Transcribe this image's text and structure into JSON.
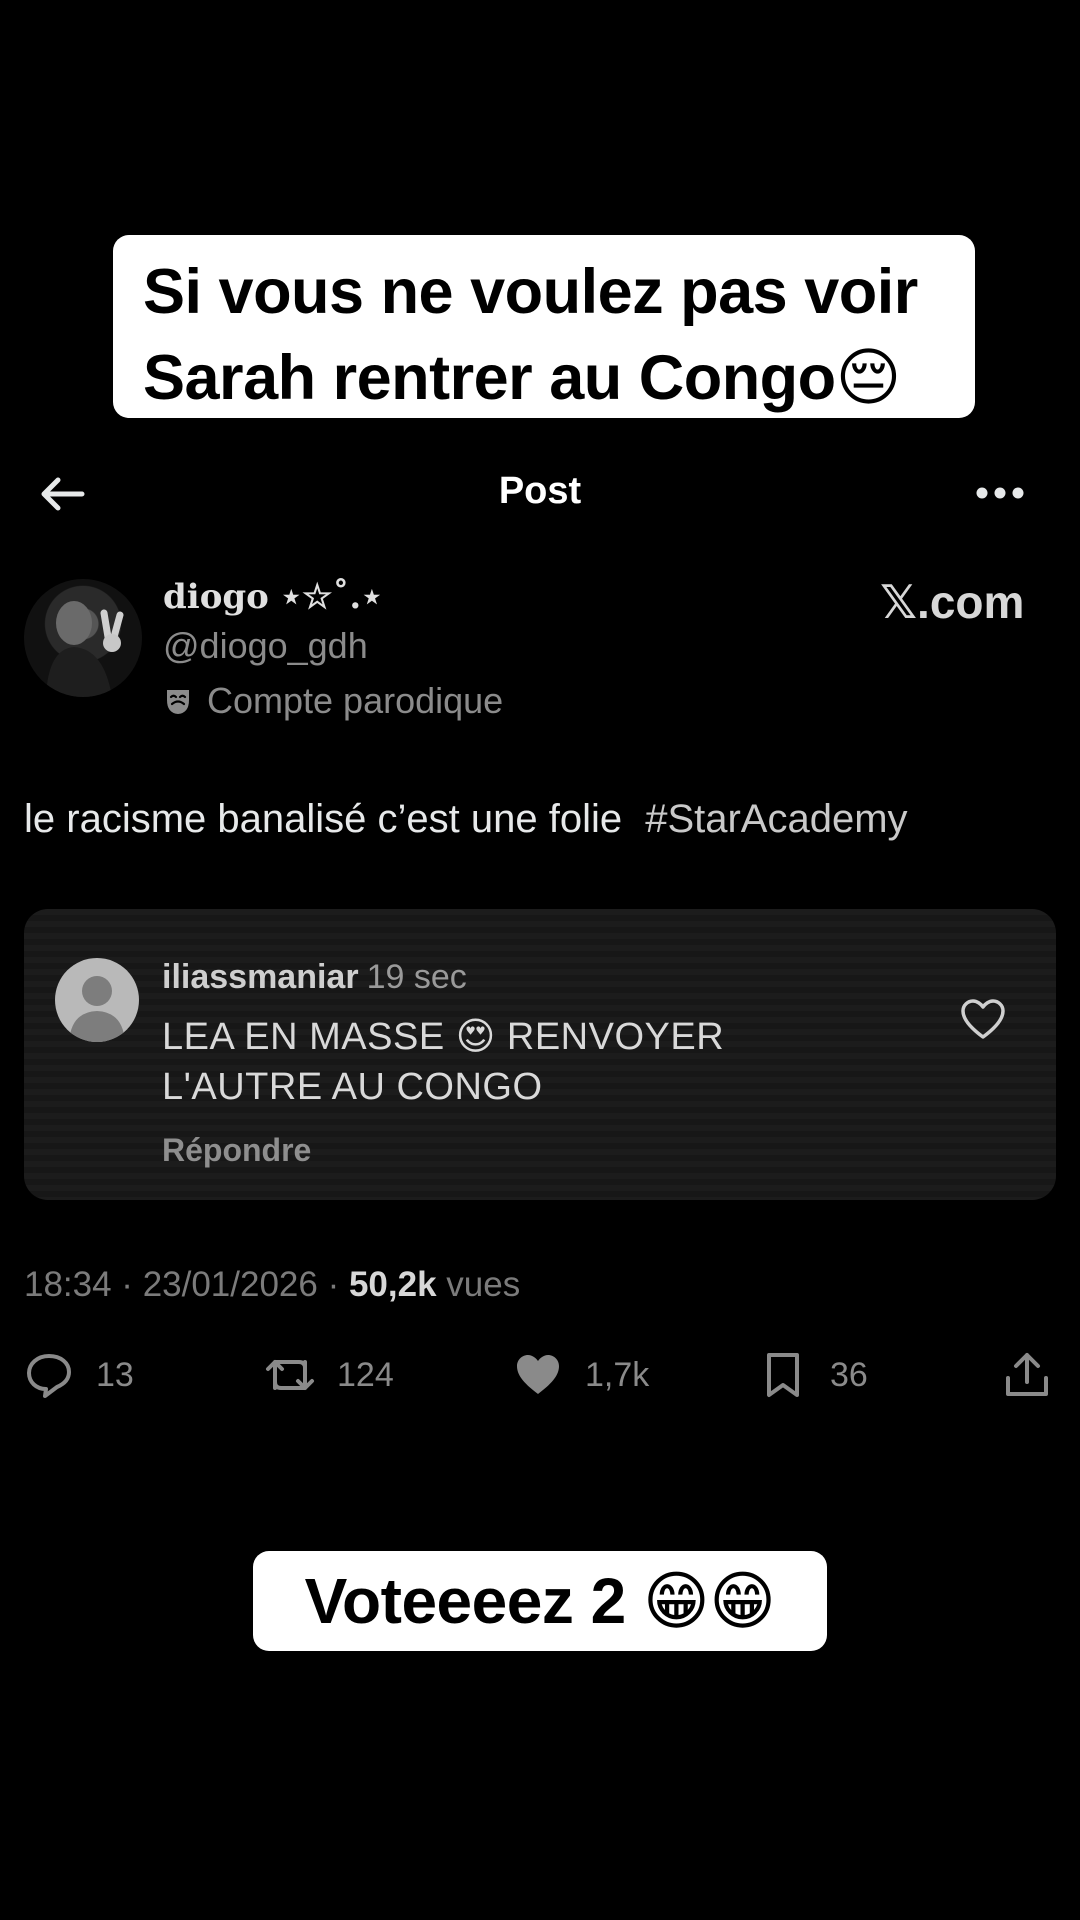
{
  "caption_top": {
    "line1": "Si vous ne voulez pas voir",
    "line2": "Sarah rentrer au Congo😔"
  },
  "caption_bottom": "Voteeeez 2 😁😁",
  "header": {
    "title": "Post"
  },
  "author": {
    "display_name": "diogo ⋆☆˚.⋆",
    "handle": "@diogo_gdh",
    "parody_label": "Compte parodique"
  },
  "brand": "𝕏.com",
  "tweet": {
    "text": "le racisme banalisé c’est une folie ",
    "hashtag": "#StarAcademy"
  },
  "comment": {
    "author": "iliassmaniar",
    "time": "19 sec",
    "text": "LEA EN MASSE 😍 RENVOYER L'AUTRE AU CONGO",
    "reply_label": "Répondre"
  },
  "meta": {
    "time_date": "18:34 · 23/01/2026 · ",
    "views_count": "50,2k",
    "views_label": " vues"
  },
  "actions": {
    "replies": "13",
    "reposts": "124",
    "likes": "1,7k",
    "bookmarks": "36"
  },
  "icons": [
    "back-arrow-icon",
    "more-icon",
    "parody-mask-icon",
    "heart-outline-icon",
    "reply-icon",
    "repost-icon",
    "like-icon",
    "bookmark-icon",
    "share-icon"
  ]
}
